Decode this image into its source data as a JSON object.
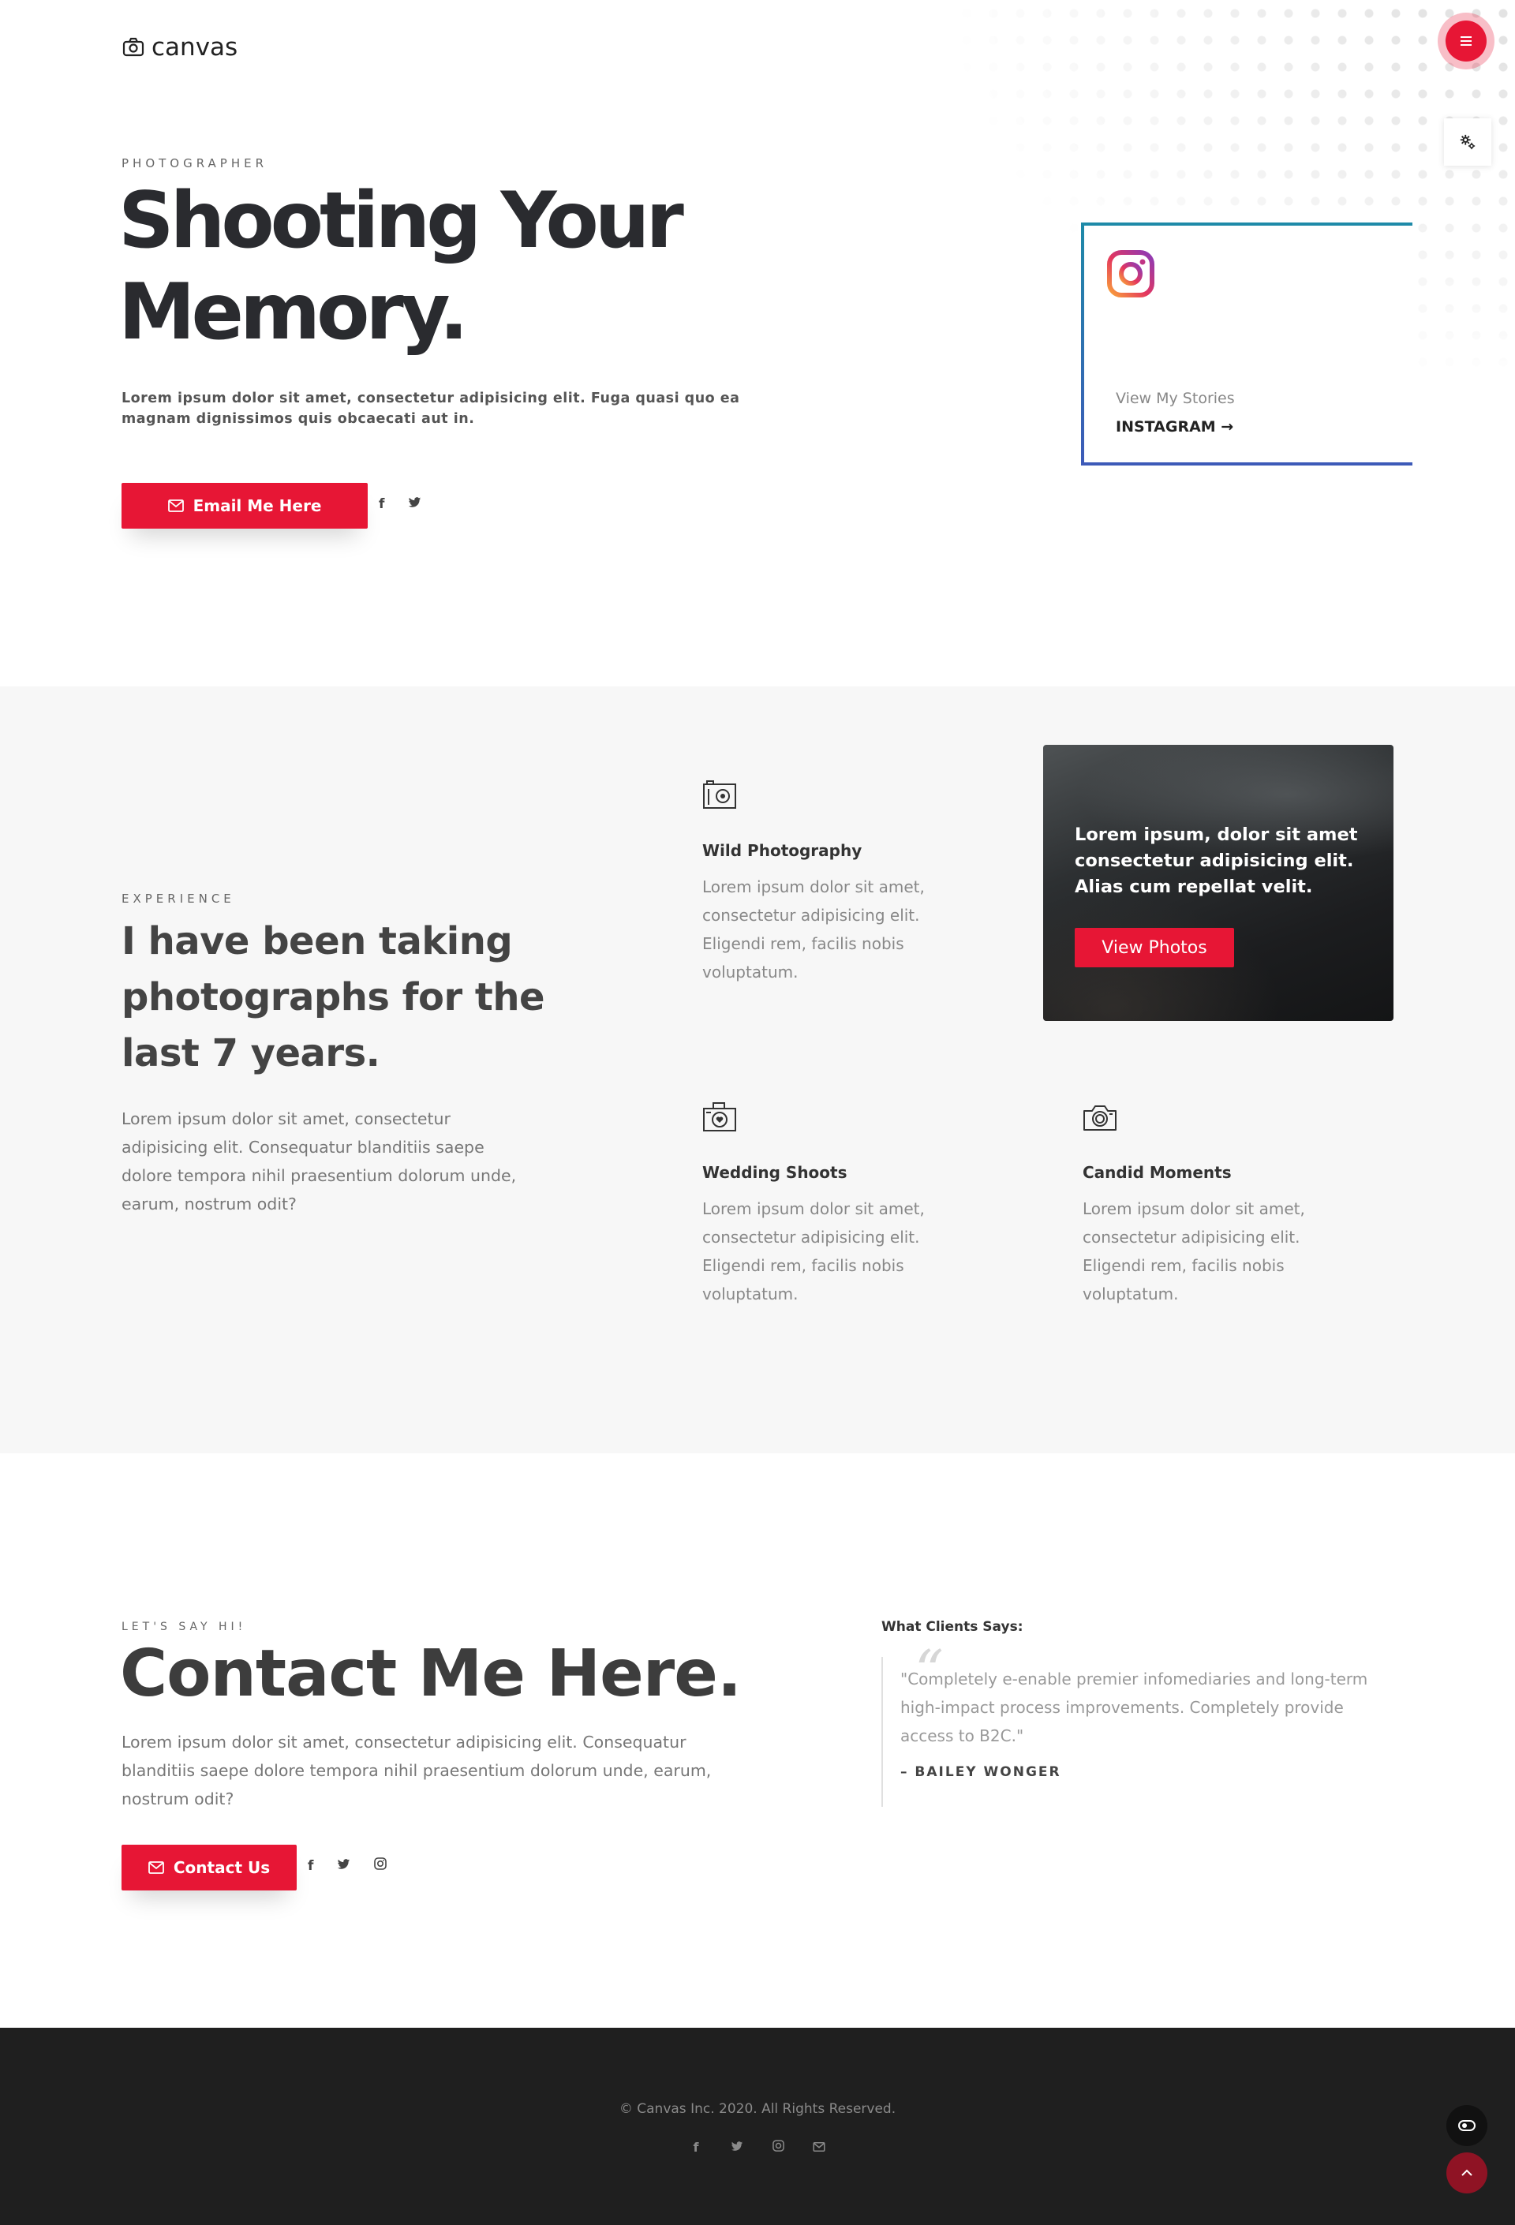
{
  "brand": {
    "name": "canvas",
    "icon": "camera-icon"
  },
  "header": {
    "menu_icon": "hamburger-icon",
    "settings_icon": "gear-icon"
  },
  "hero": {
    "eyebrow": "PHOTOGRAPHER",
    "title_line1": "Shooting Your",
    "title_line2": "Memory.",
    "description": "Lorem ipsum dolor sit amet, consectetur adipisicing elit. Fuga quasi quo ea magnam dignissimos quis obcaecati aut in.",
    "cta_label": "Email Me Here",
    "social": [
      "f",
      "✈"
    ],
    "instagram_card": {
      "caption": "View My Stories",
      "link_label": "INSTAGRAM →"
    }
  },
  "experience": {
    "eyebrow": "EXPERIENCE",
    "title": "I have been taking photographs for the last 7 years.",
    "description": "Lorem ipsum dolor sit amet, consectetur adipisicing elit. Consequatur blanditiis saepe dolore tempora nihil praesentium dolorum unde, earum, nostrum odit?",
    "features": [
      {
        "title": "Wild Photography",
        "text": "Lorem ipsum dolor sit amet, consectetur adipisicing elit. Eligendi rem, facilis nobis voluptatum.",
        "icon": "camera-icon"
      },
      {
        "title": "Wedding Shoots",
        "text": "Lorem ipsum dolor sit amet, consectetur adipisicing elit. Eligendi rem, facilis nobis voluptatum.",
        "icon": "camera-heart-icon"
      },
      {
        "title": "Candid Moments",
        "text": "Lorem ipsum dolor sit amet, consectetur adipisicing elit. Eligendi rem, facilis nobis voluptatum.",
        "icon": "camera-lens-icon"
      }
    ],
    "photo_card": {
      "text": "Lorem ipsum, dolor sit amet consectetur adipisicing elit. Alias cum repellat velit.",
      "button_label": "View Photos"
    }
  },
  "contact": {
    "eyebrow": "LET'S SAY HI!",
    "title": "Contact Me Here.",
    "description": "Lorem ipsum dolor sit amet, consectetur adipisicing elit. Consequatur blanditiis saepe dolore tempora nihil praesentium dolorum unde, earum, nostrum odit?",
    "cta_label": "Contact Us",
    "testimonial": {
      "heading": "What Clients Says:",
      "quote": "\"Completely e-enable premier infomediaries and long-term high-impact process improvements. Completely provide access to B2C.\"",
      "author": "– BAILEY WONGER"
    }
  },
  "footer": {
    "copyright": "© Canvas Inc. 2020. All Rights Reserved."
  },
  "colors": {
    "accent": "#e71635",
    "footer_bg": "#1f1f1f",
    "section_bg": "#f7f7f7"
  }
}
